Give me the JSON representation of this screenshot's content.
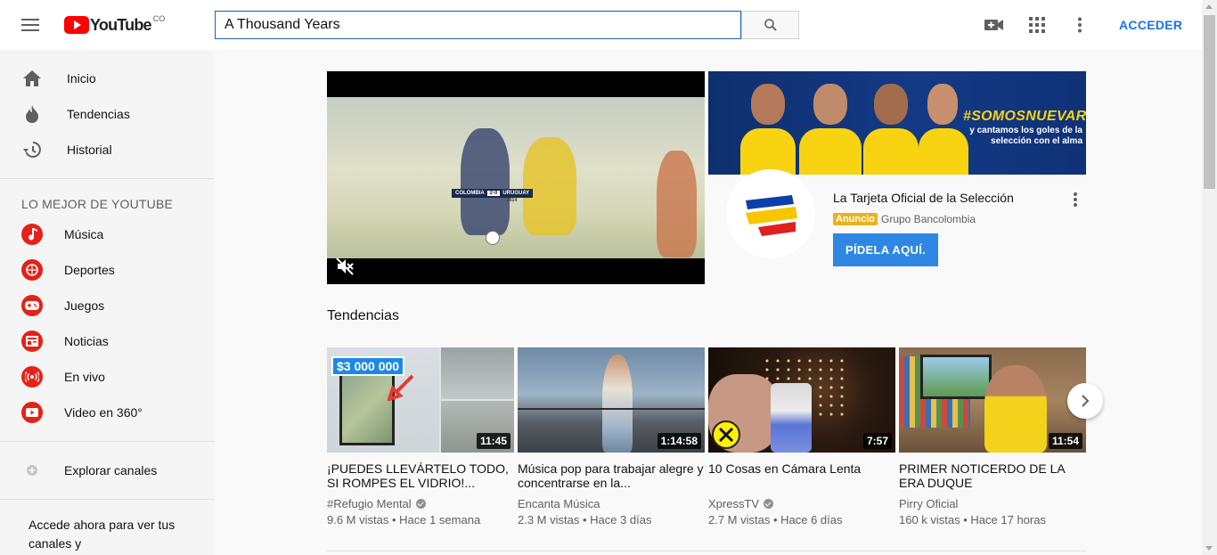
{
  "header": {
    "logo_text": "YouTube",
    "logo_country": "CO",
    "search_value": "A Thousand Years",
    "signin_label": "ACCEDER"
  },
  "sidebar": {
    "main_items": [
      {
        "label": "Inicio",
        "icon": "home-icon"
      },
      {
        "label": "Tendencias",
        "icon": "flame-icon"
      },
      {
        "label": "Historial",
        "icon": "history-icon"
      }
    ],
    "best_heading": "LO MEJOR DE YOUTUBE",
    "best_items": [
      {
        "label": "Música",
        "icon": "music-icon"
      },
      {
        "label": "Deportes",
        "icon": "sports-icon"
      },
      {
        "label": "Juegos",
        "icon": "gamepad-icon"
      },
      {
        "label": "Noticias",
        "icon": "news-icon"
      },
      {
        "label": "En vivo",
        "icon": "live-icon"
      },
      {
        "label": "Video en 360°",
        "icon": "video-360-icon"
      }
    ],
    "explore_label": "Explorar canales",
    "signin_note": "Accede ahora para ver tus canales y recomendaciones."
  },
  "ad": {
    "scoreboard_left": "COLOMBIA",
    "scoreboard_score": "2-0",
    "scoreboard_right": "URUGUAY",
    "scoreboard_year": "2014",
    "banner_tag": "#SOMOSNUEVARAZA",
    "banner_sub": "y cantamos los goles de la selección con el alma",
    "title": "La Tarjeta Oficial de la Selección",
    "badge": "Anuncio",
    "advertiser": "Grupo Bancolombia",
    "cta": "PÍDELA AQUÍ."
  },
  "trending": {
    "title": "Tendencias",
    "videos": [
      {
        "title": "¡PUEDES LLEVÁRTELO TODO, SI ROMPES EL VIDRIO!...",
        "channel": "#Refugio Mental",
        "verified": true,
        "meta": "9.6 M vistas • Hace 1 semana",
        "duration": "11:45",
        "overlay_text": "$3 000 000"
      },
      {
        "title": "Música pop para trabajar alegre y concentrarse en la...",
        "channel": "Encanta Música",
        "verified": false,
        "meta": "2.3 M vistas • Hace 3 días",
        "duration": "1:14:58"
      },
      {
        "title": "10 Cosas en Cámara Lenta",
        "channel": "XpressTV",
        "verified": true,
        "meta": "2.7 M vistas • Hace 6 días",
        "duration": "7:57"
      },
      {
        "title": "PRIMER NOTICERDO DE LA ERA DUQUE",
        "channel": "Pirry Oficial",
        "verified": false,
        "meta": "160 k vistas • Hace 17 horas",
        "duration": "11:54"
      }
    ]
  },
  "colors": {
    "brand_red": "#ff0000",
    "link_blue": "#1a73e8",
    "ad_badge": "#e8b320"
  }
}
